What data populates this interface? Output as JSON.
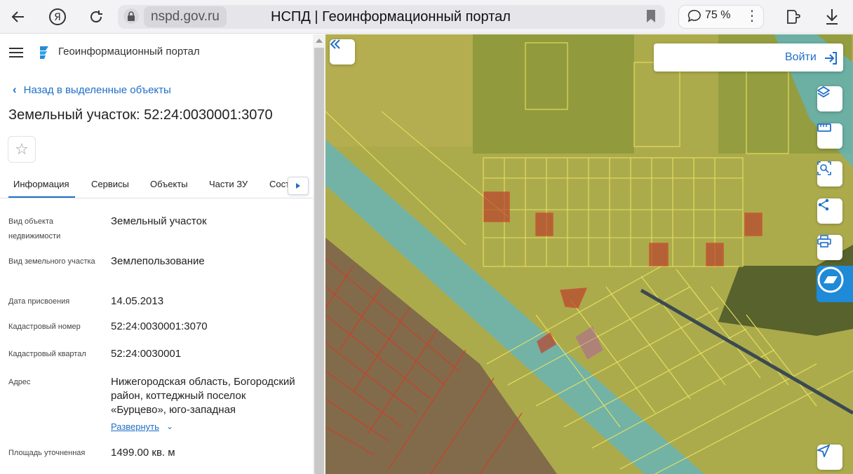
{
  "browser": {
    "domain": "nspd.gov.ru",
    "page_title": "НСПД | Геоинформационный портал",
    "zoom": "75 %"
  },
  "header": {
    "portal_name": "Геоинформационный портал"
  },
  "panel": {
    "back_label": "Назад в выделенные объекты",
    "title": "Земельный участок: 52:24:0030001:3070",
    "tabs": [
      {
        "label": "Информация"
      },
      {
        "label": "Сервисы"
      },
      {
        "label": "Объекты"
      },
      {
        "label": "Части ЗУ"
      },
      {
        "label": "Сост"
      }
    ],
    "properties": [
      {
        "label": "Вид объекта недвижимости",
        "value": "Земельный участок"
      },
      {
        "label": "Вид земельного участка",
        "value": "Землепользование"
      },
      {
        "label": "Дата присвоения",
        "value": "14.05.2013"
      },
      {
        "label": "Кадастровый номер",
        "value": "52:24:0030001:3070"
      },
      {
        "label": "Кадастровый квартал",
        "value": "52:24:0030001"
      },
      {
        "label": "Адрес",
        "value": "Нижегородская область, Богородский район, коттеджный поселок «Бурцево», юго-западная"
      },
      {
        "label": "Площадь уточненная",
        "value": "1499.00 кв. м"
      }
    ],
    "expand_label": "Развернуть"
  },
  "map": {
    "login_label": "Войти",
    "colors": {
      "zone_yellow": "#c9c34a",
      "zone_blue": "#5fb5c4",
      "parcel_red": "#d43a2a",
      "selected": "#b03cc8",
      "accent": "#1e6fc8"
    }
  }
}
